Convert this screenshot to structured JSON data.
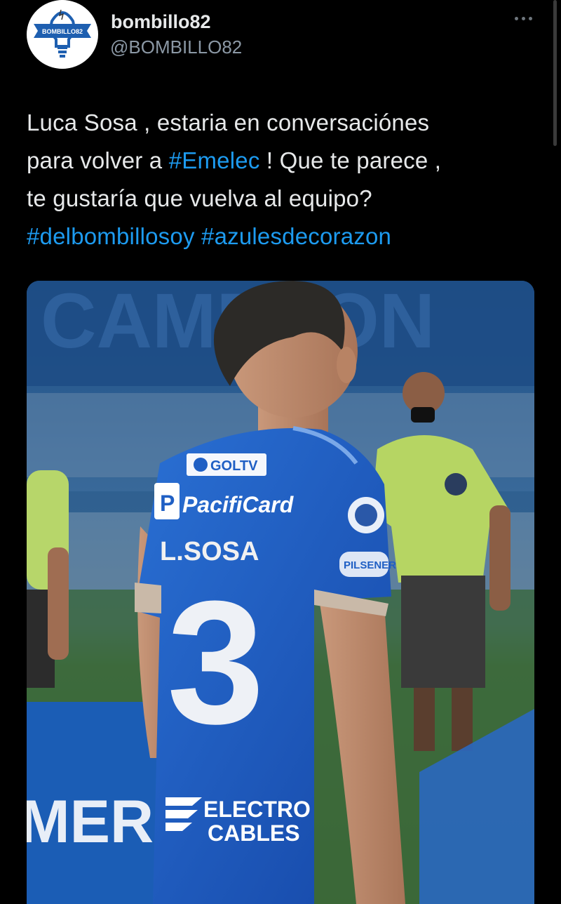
{
  "tweet": {
    "author": {
      "display_name": "bombillo82",
      "handle": "@BOMBILLO82",
      "avatar_text": "BOMBILLO82"
    },
    "more_icon": "more-horizontal-icon",
    "text": {
      "line1": "Luca Sosa , estaria en conversaciónes",
      "line2_pre": "para volver a ",
      "line2_tag": "#Emelec",
      "line2_post": " ! Que te parece ,",
      "line3": "te gustaría que vuelva al equipo?",
      "tag1": "#delbombillosoy",
      "tag2": "#azulesdecorazon"
    },
    "media": {
      "jersey": {
        "sponsor_top": "GOLTV",
        "sponsor_main": "PacifiCard",
        "player_name": "L.SOSA",
        "number": "3",
        "sleeve": "PILSENER",
        "sponsor_bottom_1": "ELECTRO",
        "sponsor_bottom_2": "CABLES"
      },
      "banner_left": "MERI",
      "stadium_text": "CAMPEON"
    }
  },
  "colors": {
    "background": "#000000",
    "text": "#e7e9ea",
    "secondary": "#8b98a5",
    "link": "#1d9bf0",
    "jersey_blue": "#1f5fc4"
  }
}
